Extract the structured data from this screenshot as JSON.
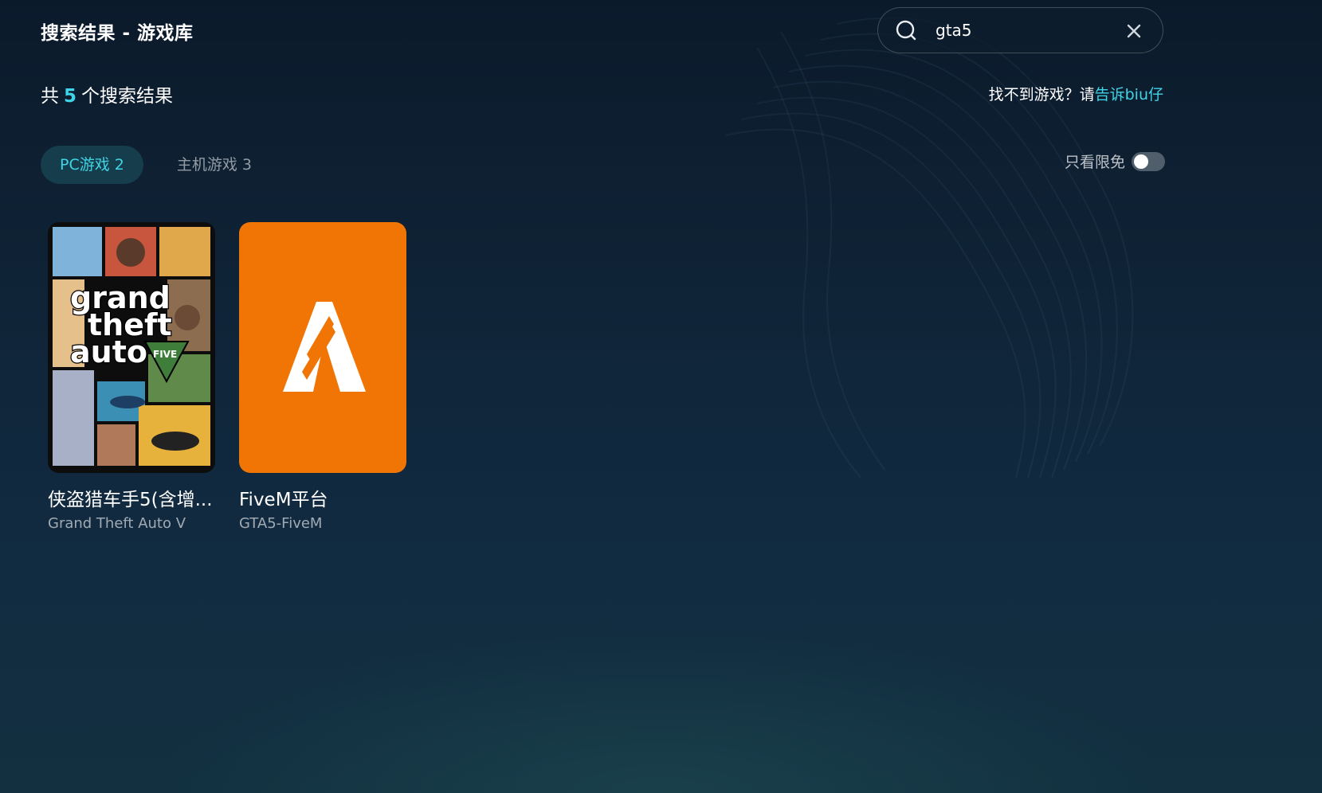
{
  "header": {
    "title": "搜索结果 - 游戏库"
  },
  "search": {
    "value": "gta5",
    "icon": "search-icon",
    "clear_icon": "close-icon"
  },
  "results": {
    "prefix": "共",
    "count": "5",
    "suffix": "个搜索结果"
  },
  "help": {
    "text": "找不到游戏？请",
    "link": "告诉biu仔"
  },
  "tabs": [
    {
      "label": "PC游戏 2",
      "active": true
    },
    {
      "label": "主机游戏 3",
      "active": false
    }
  ],
  "filter": {
    "label": "只看限免",
    "enabled": false
  },
  "games": [
    {
      "title": "侠盗猎车手5(含增...",
      "subtitle": "Grand Theft Auto V",
      "cover_text": [
        "grand",
        "theft",
        "auto"
      ],
      "cover_badge": "FIVE"
    },
    {
      "title": "FiveM平台",
      "subtitle": "GTA5-FiveM",
      "cover_color": "#f07505"
    }
  ],
  "colors": {
    "accent": "#3fd4e6",
    "background": "#0f2336",
    "tab_active_bg": "#153d4b",
    "fivem_orange": "#f07505"
  }
}
